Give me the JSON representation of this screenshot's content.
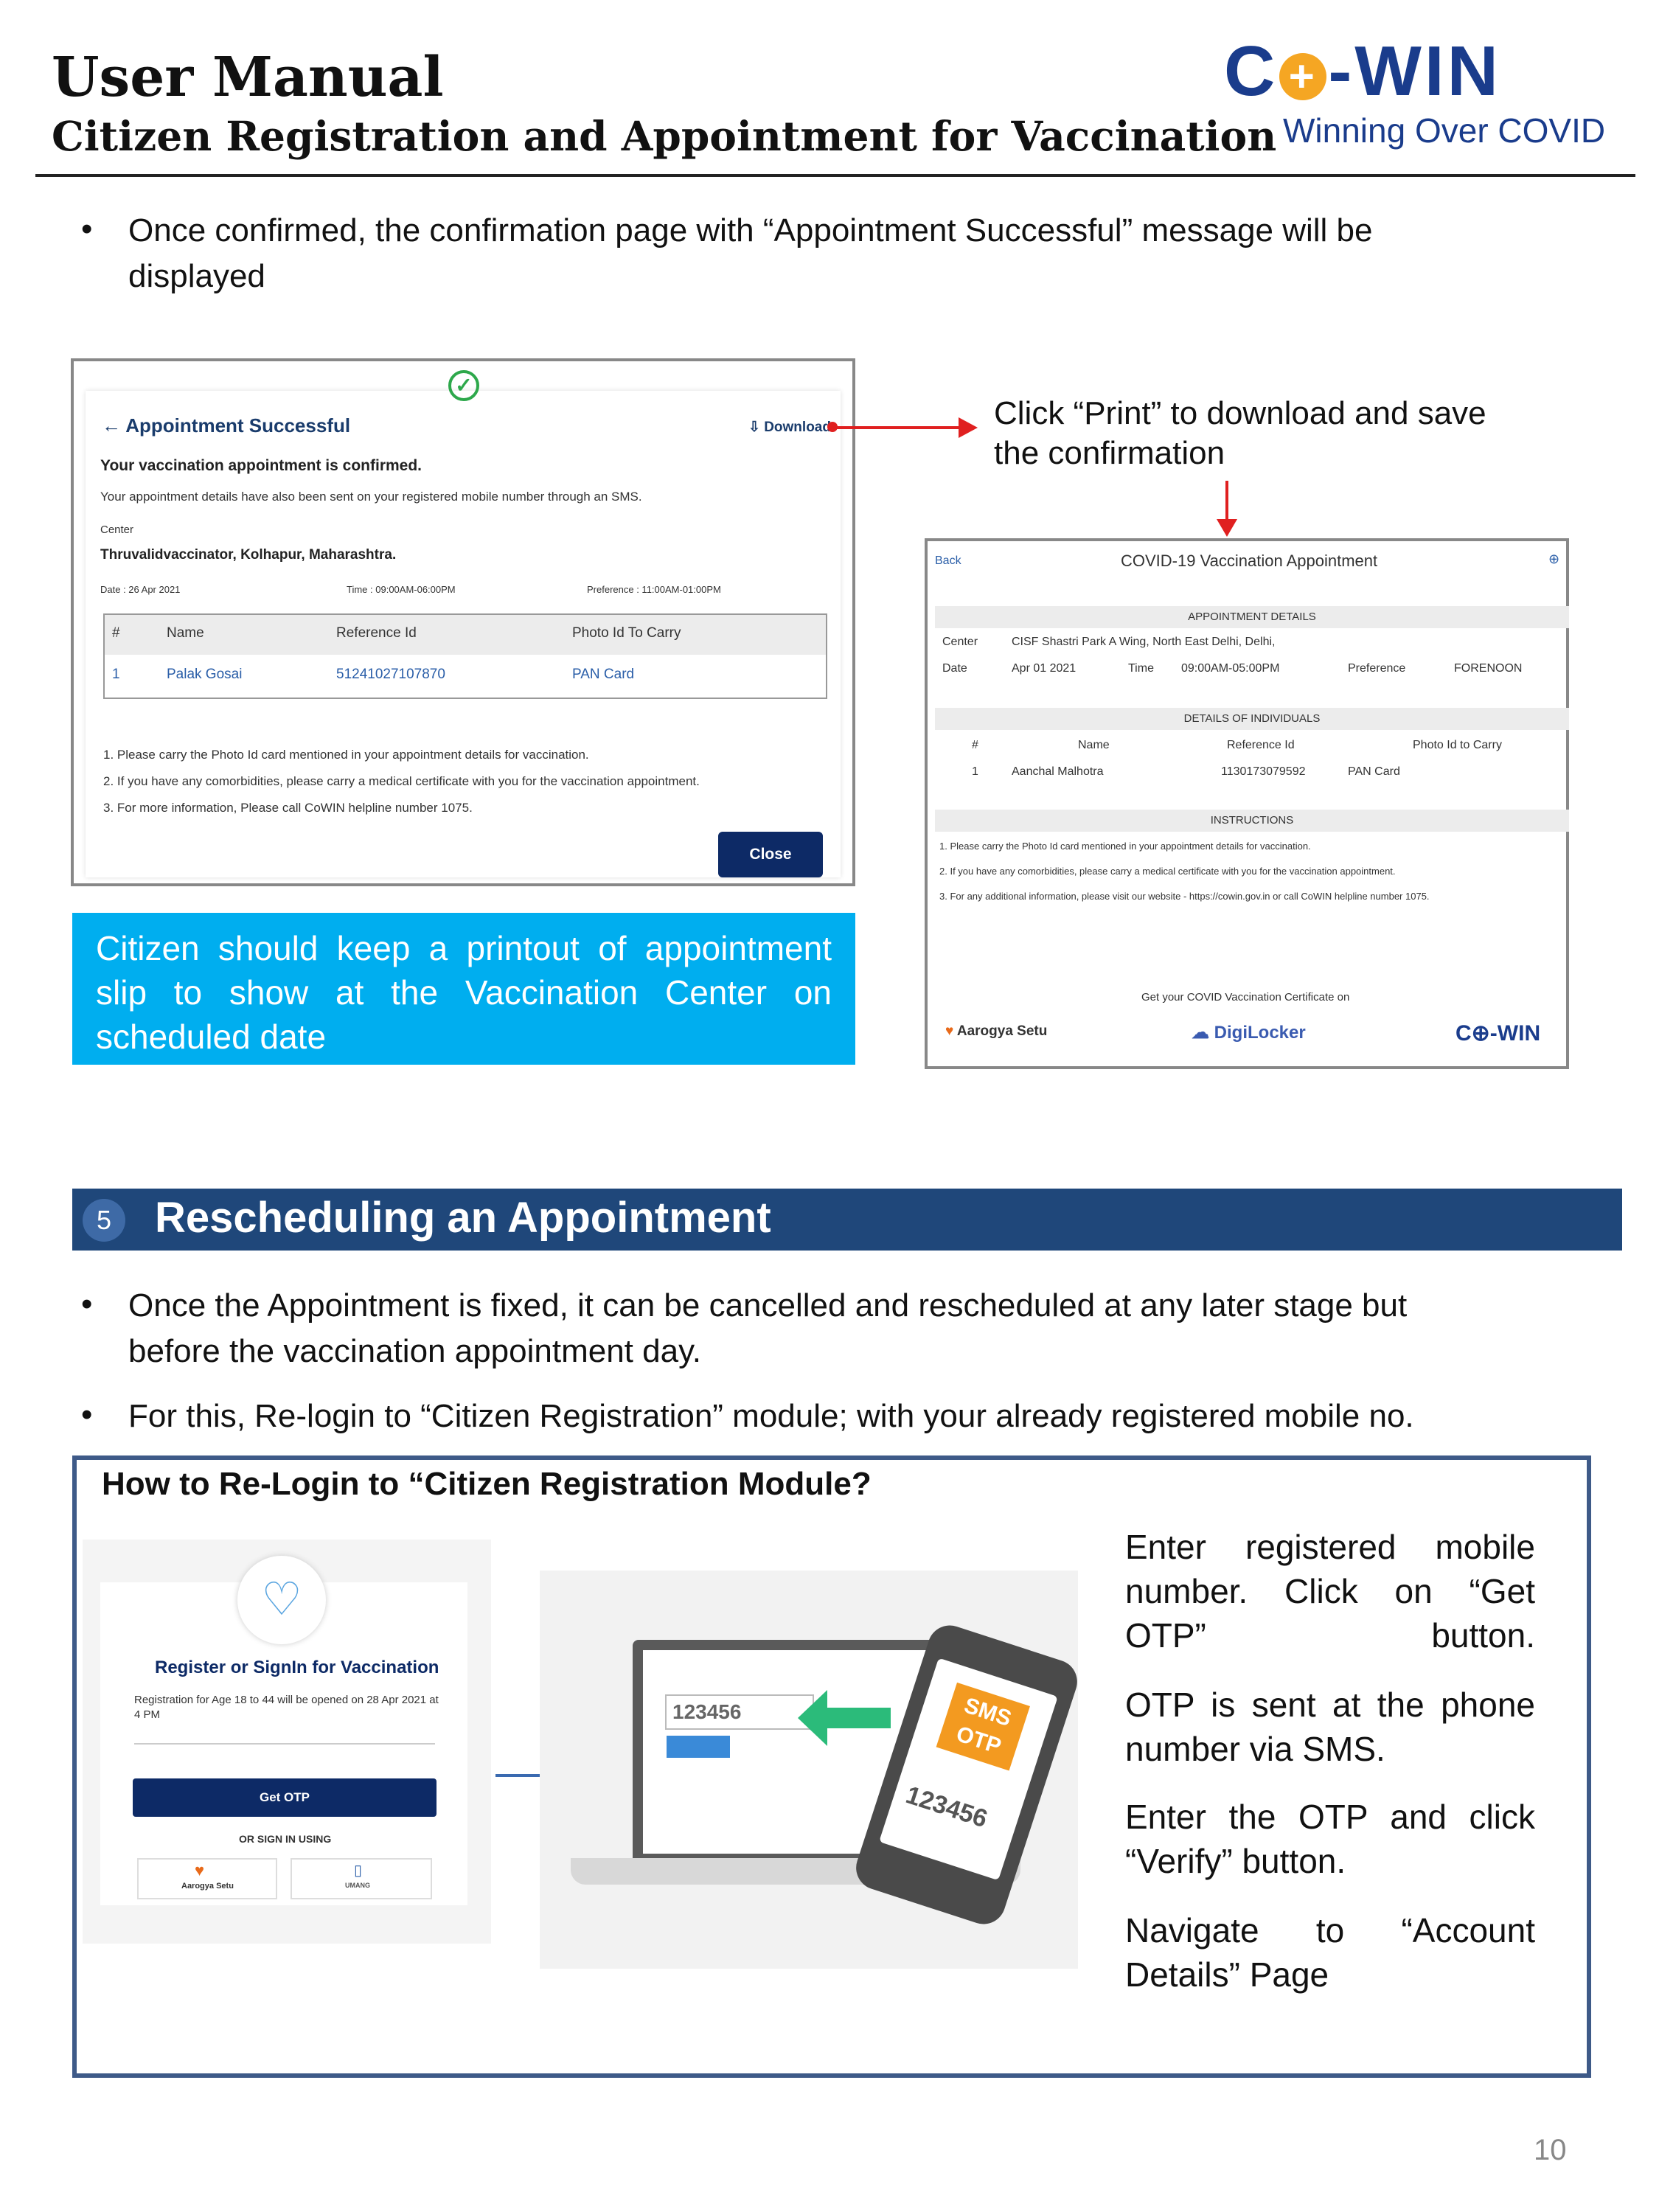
{
  "header": {
    "title": "User Manual",
    "subtitle": "Citizen Registration and Appointment for Vaccination",
    "logo_left": "C",
    "logo_right": "-WIN",
    "logo_tagline": "Winning Over COVID"
  },
  "bullets_top": [
    {
      "line1": "Once confirmed, the confirmation page with “Appointment Successful” message will be",
      "line2": "displayed"
    }
  ],
  "shot1": {
    "heading": "← Appointment Successful",
    "download": "Download",
    "confirmed": "Your vaccination appointment is confirmed.",
    "sent": "Your appointment details have also been sent on your registered mobile number through an SMS.",
    "center_label": "Center",
    "center": "Thruvalidvaccinator, Kolhapur, Maharashtra.",
    "date": "Date : 26 Apr 2021",
    "time": "Time : 09:00AM-06:00PM",
    "preference": "Preference : 11:00AM-01:00PM",
    "table_headers": [
      "#",
      "Name",
      "Reference Id",
      "Photo Id To Carry"
    ],
    "table_row": [
      "1",
      "Palak Gosai",
      "51241027107870",
      "PAN Card"
    ],
    "notes": [
      "1. Please carry the Photo Id card mentioned in your appointment details for vaccination.",
      "2. If you have any comorbidities, please carry a medical certificate with you for the vaccination appointment.",
      "3. For more information, Please call CoWIN helpline number 1075."
    ],
    "close": "Close"
  },
  "callout": {
    "line1": "Citizen should keep a printout of appointment",
    "line2": "slip to show at the Vaccination Center on",
    "line3": "scheduled date"
  },
  "annotation": {
    "line1": "Click “Print” to download and save",
    "line2": "the confirmation"
  },
  "shot2": {
    "back": "Back",
    "title": "COVID-19 Vaccination Appointment",
    "appointment_details": "APPOINTMENT DETAILS",
    "center_label": "Center",
    "center": "CISF Shastri Park A Wing, North East Delhi, Delhi,",
    "date_label": "Date",
    "date": "Apr 01 2021",
    "time_label": "Time",
    "time": "09:00AM-05:00PM",
    "pref_label": "Preference",
    "pref": "FORENOON",
    "individuals": "DETAILS OF INDIVIDUALS",
    "ind_headers": [
      "#",
      "Name",
      "Reference Id",
      "Photo Id to Carry"
    ],
    "ind_row": [
      "1",
      "Aanchal Malhotra",
      "1130173079592",
      "PAN Card"
    ],
    "instructions": "INSTRUCTIONS",
    "inst": [
      "1. Please carry the Photo Id card mentioned in your appointment details for vaccination.",
      "2. If you have any comorbidities, please carry a medical certificate with you for the vaccination appointment.",
      "3. For any additional information, please visit our website - https://cowin.gov.in or call CoWIN helpline number 1075."
    ],
    "cert": "Get your COVID Vaccination Certificate on",
    "aarogya": "Aarogya Setu",
    "digilocker": "DigiLocker",
    "cowin": "C⊕-WIN"
  },
  "section": {
    "number": "5",
    "title": "Rescheduling an Appointment"
  },
  "bullets_mid": [
    {
      "line1": "Once the Appointment is fixed, it can be cancelled and rescheduled at any later stage but",
      "line2": "before the vaccination appointment day."
    },
    {
      "line1": "For this, Re-login to “Citizen Registration” module; with your already registered mobile no."
    }
  ],
  "relogin": {
    "title": "How to Re-Login to “Citizen  Registration Module?",
    "login_title": "Register or SignIn for Vaccination",
    "login_note": "Registration for Age 18 to 44 will be opened on 28 Apr 2021 at 4 PM",
    "get_otp": "Get OTP",
    "or_sign": "OR SIGN IN USING",
    "aarogya": "Aarogya Setu",
    "umang": "UMANG",
    "laptop_code": "123456",
    "sms": "SMS",
    "otp": "OTP",
    "phone_code": "123456",
    "steps": [
      "Enter registered mobile number. Click on “Get OTP” button.",
      "OTP is sent at the phone number via SMS.",
      "Enter the OTP and click “Verify” button.",
      "Navigate to “Account Details” Page"
    ]
  },
  "page_number": "10"
}
